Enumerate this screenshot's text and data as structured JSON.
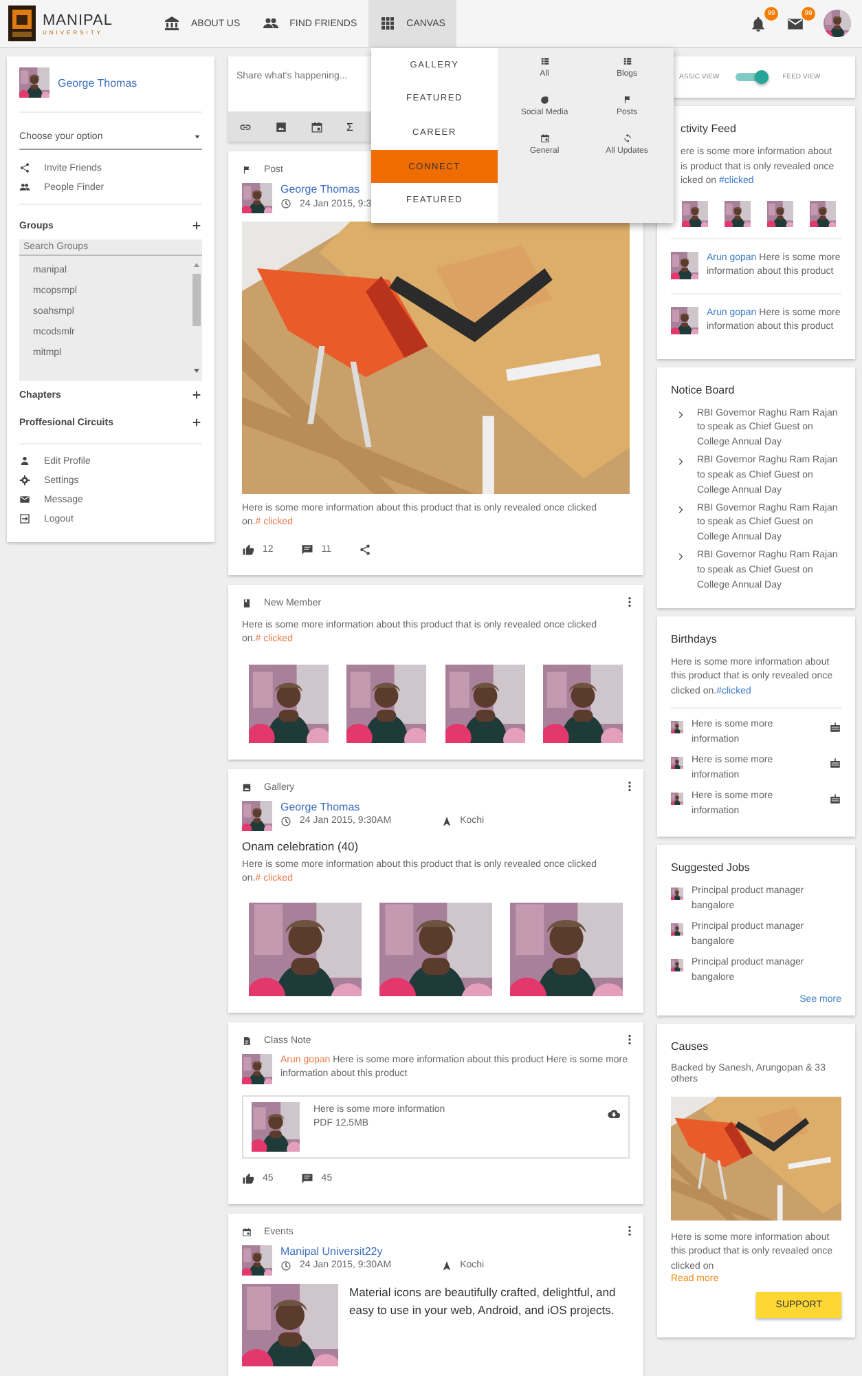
{
  "top_bar": {
    "logo_title": "MANIPAL",
    "logo_subtitle": "UNIVERSITY",
    "nav": [
      {
        "label": "ABOUT US",
        "selected": false
      },
      {
        "label": "FIND FRIENDS",
        "selected": false
      },
      {
        "label": "CANVAS",
        "selected": true
      }
    ],
    "notifications_badge": "99",
    "messages_badge": "99"
  },
  "canvas_menu": {
    "items": [
      {
        "label": "GALLERY",
        "selected": false
      },
      {
        "label": "FEATURED",
        "selected": false
      },
      {
        "label": "CAREER",
        "selected": false
      },
      {
        "label": "CONNECT",
        "selected": true
      },
      {
        "label": "FEATURED",
        "selected": false
      }
    ],
    "shortcuts": [
      {
        "label": "All"
      },
      {
        "label": "Blogs"
      },
      {
        "label": "Social Media"
      },
      {
        "label": "Posts"
      },
      {
        "label": "General"
      },
      {
        "label": "All Updates"
      }
    ]
  },
  "sidebar": {
    "user": "George Thomas",
    "select": "Choose your option",
    "links": [
      "Invite Friends",
      "People Finder"
    ],
    "groups": {
      "title": "Groups",
      "search_placeholder": "Search Groups",
      "items": [
        "manipal",
        "mcopsmpl",
        "soahsmpl",
        "mcodsmlr",
        "mitmpl"
      ]
    },
    "sections": [
      "Chapters",
      "Proffesional Circuits"
    ],
    "menu": [
      "Edit Profile",
      "Settings",
      "Message",
      "Logout"
    ]
  },
  "composer": {
    "placeholder": "Share what's happening...",
    "formula": "Σ"
  },
  "feed": [
    {
      "kind": "post",
      "type_label": "Post",
      "more_menu": false,
      "author": "George Thomas",
      "time": "24 Jan 2015, 9:3",
      "text": "Here is some more information about this product that is only revealed once clicked on.",
      "tag": "# clicked",
      "likes": "12",
      "comments": "11"
    },
    {
      "kind": "new_member",
      "type_label": "New Member",
      "more_menu": true,
      "text": "Here is some more information about this product that is only revealed once clicked on.",
      "tag": "# clicked",
      "photos": [
        {
          "kind": "picture"
        },
        {
          "kind": "picture"
        },
        {
          "kind": "picture"
        },
        {
          "kind": "picture"
        }
      ]
    },
    {
      "kind": "gallery",
      "type_label": "Gallery",
      "more_menu": true,
      "author": "George Thomas",
      "time": "24 Jan 2015, 9:30AM",
      "location": "Kochi",
      "title": "Onam celebration (40)",
      "text": "Here is some more information about this product that is only revealed once clicked on.",
      "tag": "# clicked",
      "photos": [
        {
          "kind": "picture"
        },
        {
          "kind": "picture"
        },
        {
          "kind": "picture"
        }
      ]
    },
    {
      "kind": "class_note",
      "type_label": "Class Note",
      "more_menu": true,
      "author": "Arun gopan",
      "text": "Here is some more information about this product Here is some more information about this product",
      "attachment_title": "Here is some more information",
      "attachment_meta": "PDF 12.5MB",
      "likes": "45",
      "comments": "45"
    },
    {
      "kind": "event",
      "type_label": "Events",
      "more_menu": true,
      "author": "Manipal Universit22y",
      "time": "24 Jan 2015, 9:30AM",
      "location": "Kochi",
      "description": "Material icons are beautifully crafted, delightful, and easy to use in your web, Android, and iOS projects."
    }
  ],
  "view_toggle": {
    "left": "ASSIC VIEW",
    "right": "FEED VIEW",
    "on": true
  },
  "activity_feed": {
    "title": "ctivity Feed",
    "lines": [
      "ere is some more information about",
      "is product that is only revealed once",
      "icked on "
    ],
    "tag": "#clicked",
    "photos": [
      {
        "kind": "picture"
      },
      {
        "kind": "picture"
      },
      {
        "kind": "picture"
      },
      {
        "kind": "picture"
      }
    ],
    "entries": [
      {
        "author": "Arun gopan",
        "text": "Here is some more information about this product"
      },
      {
        "author": "Arun gopan",
        "text": "Here is some more information about this product"
      }
    ]
  },
  "notice_board": {
    "title": "Notice Board",
    "items": [
      "RBI Governor Raghu Ram Rajan to speak as Chief Guest on College Annual Day",
      "RBI Governor Raghu Ram Rajan to speak as Chief Guest on College Annual Day",
      "RBI Governor Raghu Ram Rajan to speak as Chief Guest on College Annual Day",
      "RBI Governor Raghu Ram Rajan to speak as Chief Guest on College Annual Day"
    ]
  },
  "birthdays": {
    "title": "Birthdays",
    "text": "Here is some more information about this product that is only revealed once clicked on.",
    "tag": "#clicked",
    "entries": [
      "Here is some more information",
      "Here is some more information",
      "Here is some more information"
    ]
  },
  "suggested_jobs": {
    "title": "Suggested Jobs",
    "jobs": [
      "Principal product manager bangalore",
      "Principal product manager bangalore",
      "Principal product manager bangalore"
    ],
    "link": "See more"
  },
  "causes": {
    "title": "Causes",
    "backers": "Backed by Sanesh, Arungopan & 33 others",
    "text": "Here is some more information about this product that is only revealed once clicked on",
    "link": "Read more",
    "button": "SUPPORT"
  }
}
